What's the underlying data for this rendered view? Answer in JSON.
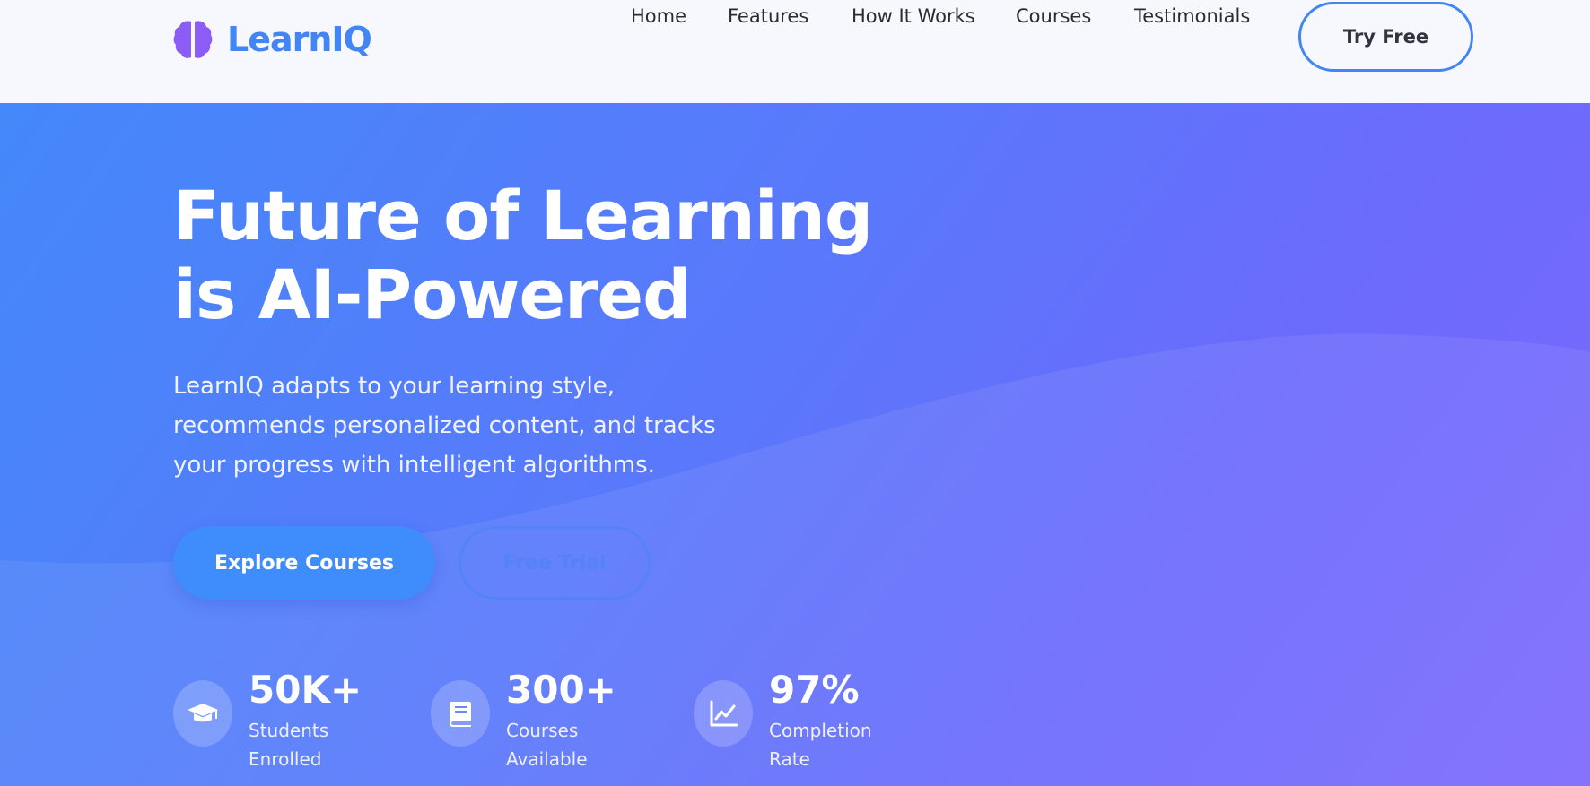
{
  "header": {
    "brand": "LearnIQ",
    "nav": [
      "Home",
      "Features",
      "How It Works",
      "Courses",
      "Testimonials"
    ],
    "cta": "Try Free"
  },
  "hero": {
    "title_line1": "Future of Learning",
    "title_line2": "is AI-Powered",
    "description": "LearnIQ adapts to your learning style, recommends personalized content, and tracks your progress with intelligent algorithms.",
    "primary_button": "Explore Courses",
    "secondary_button": "Free Trial",
    "stats": [
      {
        "value": "50K+",
        "label": "Students Enrolled",
        "icon": "graduation-cap-icon"
      },
      {
        "value": "300+",
        "label": "Courses Available",
        "icon": "book-icon"
      },
      {
        "value": "97%",
        "label": "Completion Rate",
        "icon": "chart-line-icon"
      }
    ]
  },
  "colors": {
    "brand": "#4285f4",
    "logo_icon": "#8b5cf6",
    "hero_gradient_start": "#4488fa",
    "hero_gradient_end": "#7d69fd",
    "text_dark": "#2b2b33"
  }
}
